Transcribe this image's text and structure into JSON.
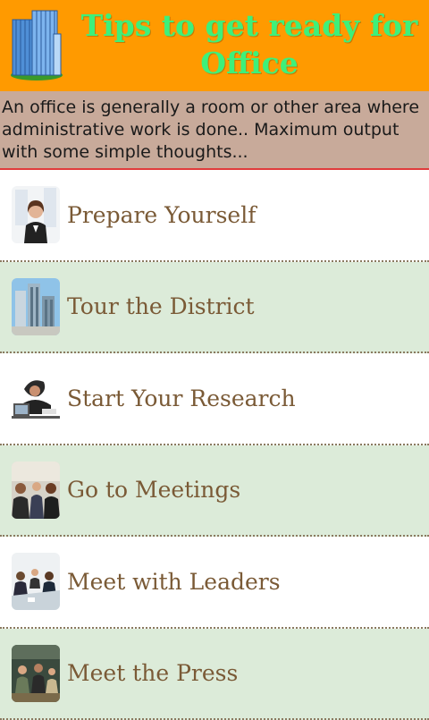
{
  "header": {
    "title": "Tips to get ready for Office",
    "logo_icon": "office-building-icon"
  },
  "description": "An office is generally a room or other area where administrative work is done.. Maximum output with some simple thoughts...",
  "items": [
    {
      "label": "Prepare Yourself",
      "icon": "businesswoman-thumbnail"
    },
    {
      "label": "Tour the District",
      "icon": "city-buildings-thumbnail"
    },
    {
      "label": "Start Your Research",
      "icon": "stressed-worker-thumbnail"
    },
    {
      "label": "Go to Meetings",
      "icon": "meeting-thumbnail"
    },
    {
      "label": "Meet with Leaders",
      "icon": "conference-table-thumbnail"
    },
    {
      "label": "Meet the Press",
      "icon": "press-conference-thumbnail"
    }
  ],
  "colors": {
    "header_bg": "#ff9a00",
    "title": "#3ef07a",
    "description_bg": "#c8aa9a",
    "alt_row_bg": "#dcebd9",
    "item_text": "#7a5a36"
  }
}
